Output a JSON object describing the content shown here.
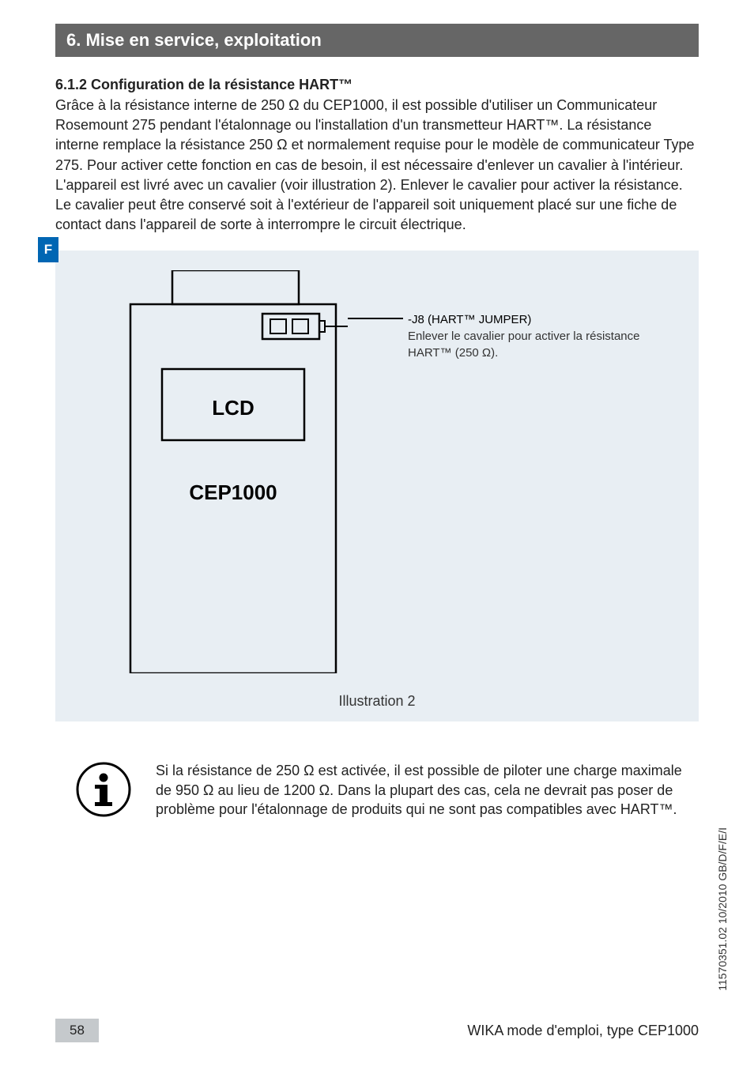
{
  "header": {
    "section_title": "6. Mise en service, exploitation"
  },
  "language_indicator": "F",
  "content": {
    "subsection_title": "6.1.2 Configuration de la résistance HART™",
    "paragraph": "Grâce à la résistance interne de 250 Ω du CEP1000, il est possible d'utiliser un Communicateur Rosemount 275 pendant l'étalonnage ou l'installation d'un transmetteur HART™. La résistance interne remplace la résistance 250 Ω et normalement requise pour le modèle de communicateur Type 275. Pour activer cette fonction en cas de besoin, il est nécessaire d'enlever un cavalier à l'intérieur. L'appareil est livré avec un cavalier (voir illustration 2). Enlever le cavalier pour activer la résistance. Le cavalier peut être conservé soit à l'extérieur de l'appareil soit uniquement placé sur une fiche de contact dans l'appareil de sorte à interrompre le circuit électrique."
  },
  "diagram": {
    "lcd_label": "LCD",
    "device_label": "CEP1000",
    "jumper_heading": "-J8 (HART™ JUMPER)",
    "jumper_description_line1": "Enlever le cavalier pour activer la résistance",
    "jumper_description_line2": "HART™ (250 Ω).",
    "caption": "Illustration 2"
  },
  "info_note": {
    "text": "Si la résistance de 250 Ω est activée, il est possible de piloter une charge maximale de 950 Ω au lieu de 1200 Ω. Dans la plupart des cas, cela ne devrait pas poser de problème pour l'étalonnage de produits qui ne sont pas compatibles avec HART™."
  },
  "footer": {
    "page_number": "58",
    "footer_text": "WIKA mode d'emploi, type CEP1000"
  },
  "doc_reference": "11570351.02 10/2010 GB/D/F/E/I"
}
